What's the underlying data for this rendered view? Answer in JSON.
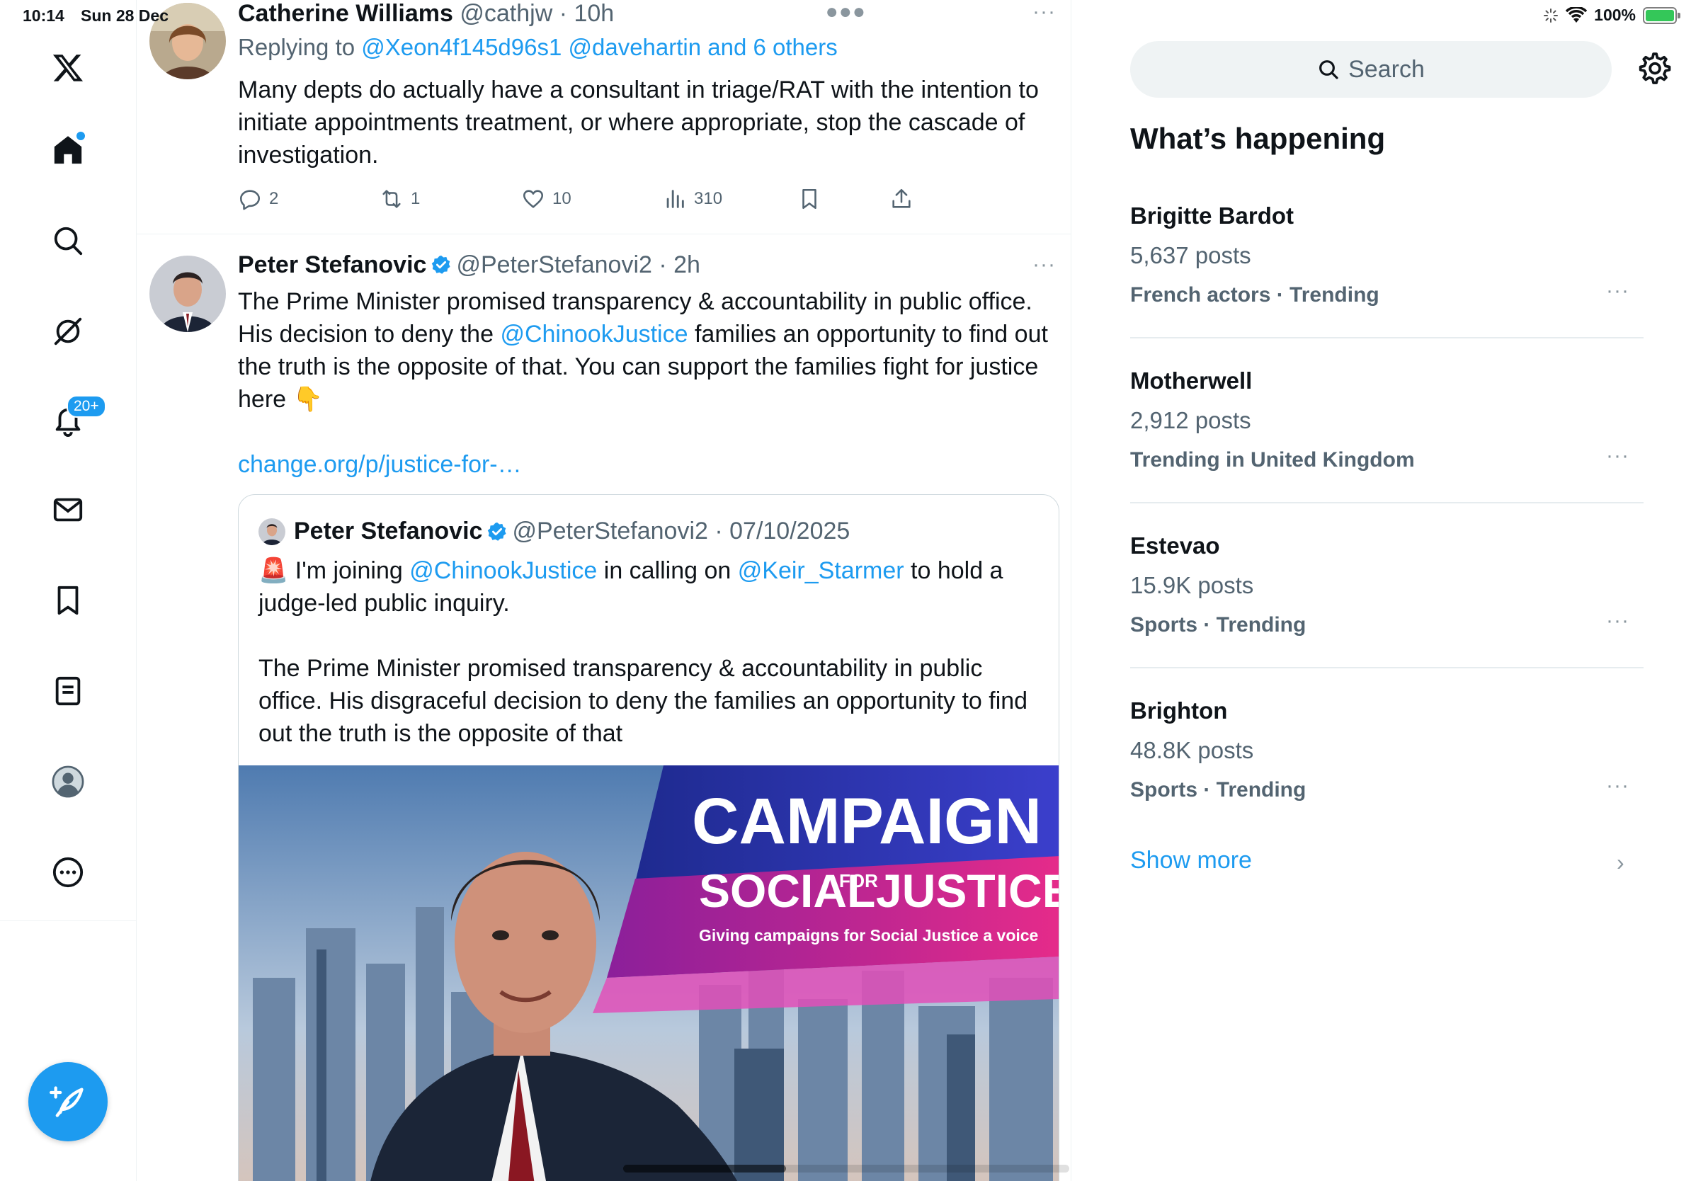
{
  "status": {
    "time": "10:14",
    "date": "Sun 28 Dec",
    "battery": "100%"
  },
  "nav": {
    "notifications_badge": "20+"
  },
  "tweet1": {
    "name": "Catherine Williams",
    "handle": "@cathjw",
    "time": "· 10h",
    "reply_prefix": "Replying to ",
    "reply_to": "@Xeon4f145d96s1 @davehartin and 6 others",
    "text": "Many depts do actually have a consultant in triage/RAT with the intention to initiate appointments treatment, or where appropriate, stop the cascade of investigation.",
    "replies": "2",
    "reposts": "1",
    "likes": "10",
    "views": "310"
  },
  "tweet2": {
    "name": "Peter Stefanovic",
    "handle": "@PeterStefanovi2",
    "time": "· 2h",
    "text_a": "The Prime Minister promised transparency & accountability in public office. His decision to deny the ",
    "mention": "@ChinookJustice",
    "text_b": " families an opportunity to find out the truth is the opposite of that. You can support the families fight for justice here 👇",
    "link": "change.org/p/justice-for-…"
  },
  "quote": {
    "name": "Peter Stefanovic",
    "handle": "@PeterStefanovi2",
    "date": "· 07/10/2025",
    "p1_a": "🚨 I'm joining ",
    "p1_m1": "@ChinookJustice",
    "p1_b": " in calling on ",
    "p1_m2": "@Keir_Starmer",
    "p1_c": " to hold a judge-led public inquiry.",
    "p2": "The Prime Minister promised transparency & accountability in public office. His disgraceful decision to deny the families an opportunity to find out the truth is the opposite of that",
    "media": {
      "banner_line1": "CAMPAIGN",
      "banner_line2a": "SOCIAL",
      "banner_line2b": "FOR",
      "banner_line2c": "JUSTICE",
      "banner_tagline": "Giving campaigns for Social Justice a voice"
    }
  },
  "sidebar": {
    "search_placeholder": "Search",
    "title": "What’s happening",
    "trends": [
      {
        "name": "Brigitte Bardot",
        "count": "5,637 posts",
        "meta": "French actors · Trending"
      },
      {
        "name": "Motherwell",
        "count": "2,912 posts",
        "meta": "Trending in United Kingdom"
      },
      {
        "name": "Estevao",
        "count": "15.9K posts",
        "meta": "Sports · Trending"
      },
      {
        "name": "Brighton",
        "count": "48.8K posts",
        "meta": "Sports · Trending"
      }
    ],
    "show_more": "Show more"
  },
  "colors": {
    "accent": "#1d9bf0",
    "secondary_text": "#536471",
    "divider": "#eff3f4"
  }
}
